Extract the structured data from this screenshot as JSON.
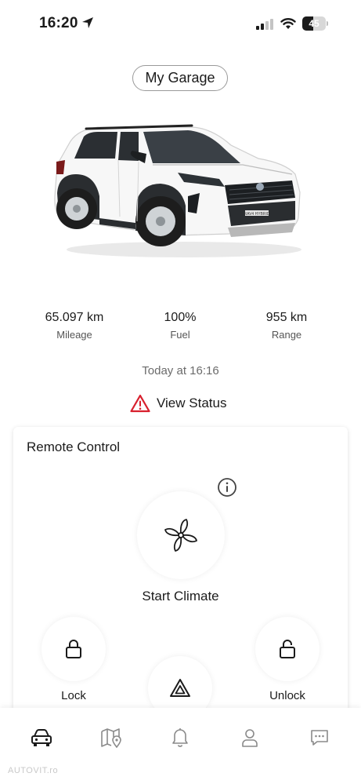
{
  "status_bar": {
    "time": "16:20",
    "battery": "45",
    "battery_level": 0.45
  },
  "header": {
    "garage_label": "My Garage"
  },
  "vehicle": {
    "model_badge": "RAV4 HYBRID"
  },
  "stats": [
    {
      "value": "65.097 km",
      "label": "Mileage"
    },
    {
      "value": "100%",
      "label": "Fuel"
    },
    {
      "value": "955 km",
      "label": "Range"
    }
  ],
  "updated": "Today at 16:16",
  "view_status": "View Status",
  "remote": {
    "title": "Remote Control",
    "climate_label": "Start Climate",
    "lock_label": "Lock",
    "unlock_label": "Unlock"
  },
  "tabs": [
    {
      "icon": "car-icon",
      "active": true
    },
    {
      "icon": "map-icon",
      "active": false
    },
    {
      "icon": "bell-icon",
      "active": false
    },
    {
      "icon": "profile-icon",
      "active": false
    },
    {
      "icon": "chat-icon",
      "active": false
    }
  ],
  "watermark": "AUTOVIT.ro",
  "colors": {
    "accent_red": "#d8202e",
    "text": "#1b1b1b",
    "muted": "#6b6b6b"
  }
}
